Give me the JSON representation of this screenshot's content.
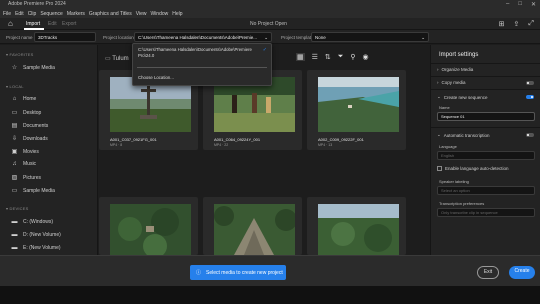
{
  "window": {
    "title": "Adobe Premiere Pro 2024"
  },
  "menu": [
    "File",
    "Edit",
    "Clip",
    "Sequence",
    "Markers",
    "Graphics and Titles",
    "View",
    "Window",
    "Help"
  ],
  "nav": {
    "tabs": [
      "Import",
      "Edit",
      "Export"
    ],
    "doc_name": "No Project Open"
  },
  "project_bar": {
    "name_label": "Project name",
    "name_value": "3DTracks",
    "location_label": "Project location",
    "location_value": "C:\\Users\\Thameena Halsdalen\\Documents\\Adobe\\Premie...",
    "template_label": "Project template",
    "template_value": "None"
  },
  "location_dropdown": {
    "option1_line1": "C:\\Users\\Thameena Halsdalen\\Documents\\Adobe\\Premiere",
    "option1_line2": "Pro\\24.0",
    "choose": "Choose Location..."
  },
  "sidebar": {
    "favorites_title": "FAVORITES",
    "favorites": [
      {
        "label": "Sample Media",
        "icon": "star-icon"
      }
    ],
    "local_title": "LOCAL",
    "local": [
      {
        "label": "Home",
        "icon": "home-icon"
      },
      {
        "label": "Desktop",
        "icon": "desktop-icon"
      },
      {
        "label": "Documents",
        "icon": "document-icon"
      },
      {
        "label": "Downloads",
        "icon": "download-icon"
      },
      {
        "label": "Movies",
        "icon": "film-icon"
      },
      {
        "label": "Music",
        "icon": "music-icon"
      },
      {
        "label": "Pictures",
        "icon": "picture-icon"
      },
      {
        "label": "Sample Media",
        "icon": "folder-icon"
      }
    ],
    "devices_title": "DEVICES",
    "devices": [
      {
        "label": "C: (Windows)",
        "icon": "drive-icon"
      },
      {
        "label": "D: (New Volume)",
        "icon": "drive-icon"
      },
      {
        "label": "E: (New Volume)",
        "icon": "drive-icon"
      }
    ]
  },
  "browser": {
    "crumb": "Tulum",
    "cards": [
      {
        "name": "A001_C037_0921FG_001",
        "meta": "MP4 · 8",
        "scene": "cross"
      },
      {
        "name": "A001_C064_09224Y_001",
        "meta": "MP4 · 22",
        "scene": "people"
      },
      {
        "name": "A002_C009_09222F_001",
        "meta": "MP4 · 13",
        "scene": "coast"
      },
      {
        "name": "",
        "meta": "",
        "scene": "jungle1"
      },
      {
        "name": "",
        "meta": "",
        "scene": "pyramid"
      },
      {
        "name": "",
        "meta": "",
        "scene": "jungle2"
      }
    ]
  },
  "import_settings": {
    "title": "Import settings",
    "organize": "Organize Media",
    "copy": "Copy media",
    "create_seq": "Create new sequence",
    "name_label": "Name",
    "name_value": "Sequence 01",
    "auto_trans": "Automatic transcription",
    "language_label": "Language",
    "language_value": "English",
    "auto_detect": "Enable language auto-detection",
    "speaker_label": "Speaker labeling",
    "speaker_value": "Select an option",
    "pref_label": "Transcription preferences",
    "pref_value": "Only transcribe clip in sequence"
  },
  "footer": {
    "toast": "Select media to create new project",
    "exit": "Exit",
    "create": "Create"
  },
  "colors": {
    "accent": "#2680eb"
  }
}
